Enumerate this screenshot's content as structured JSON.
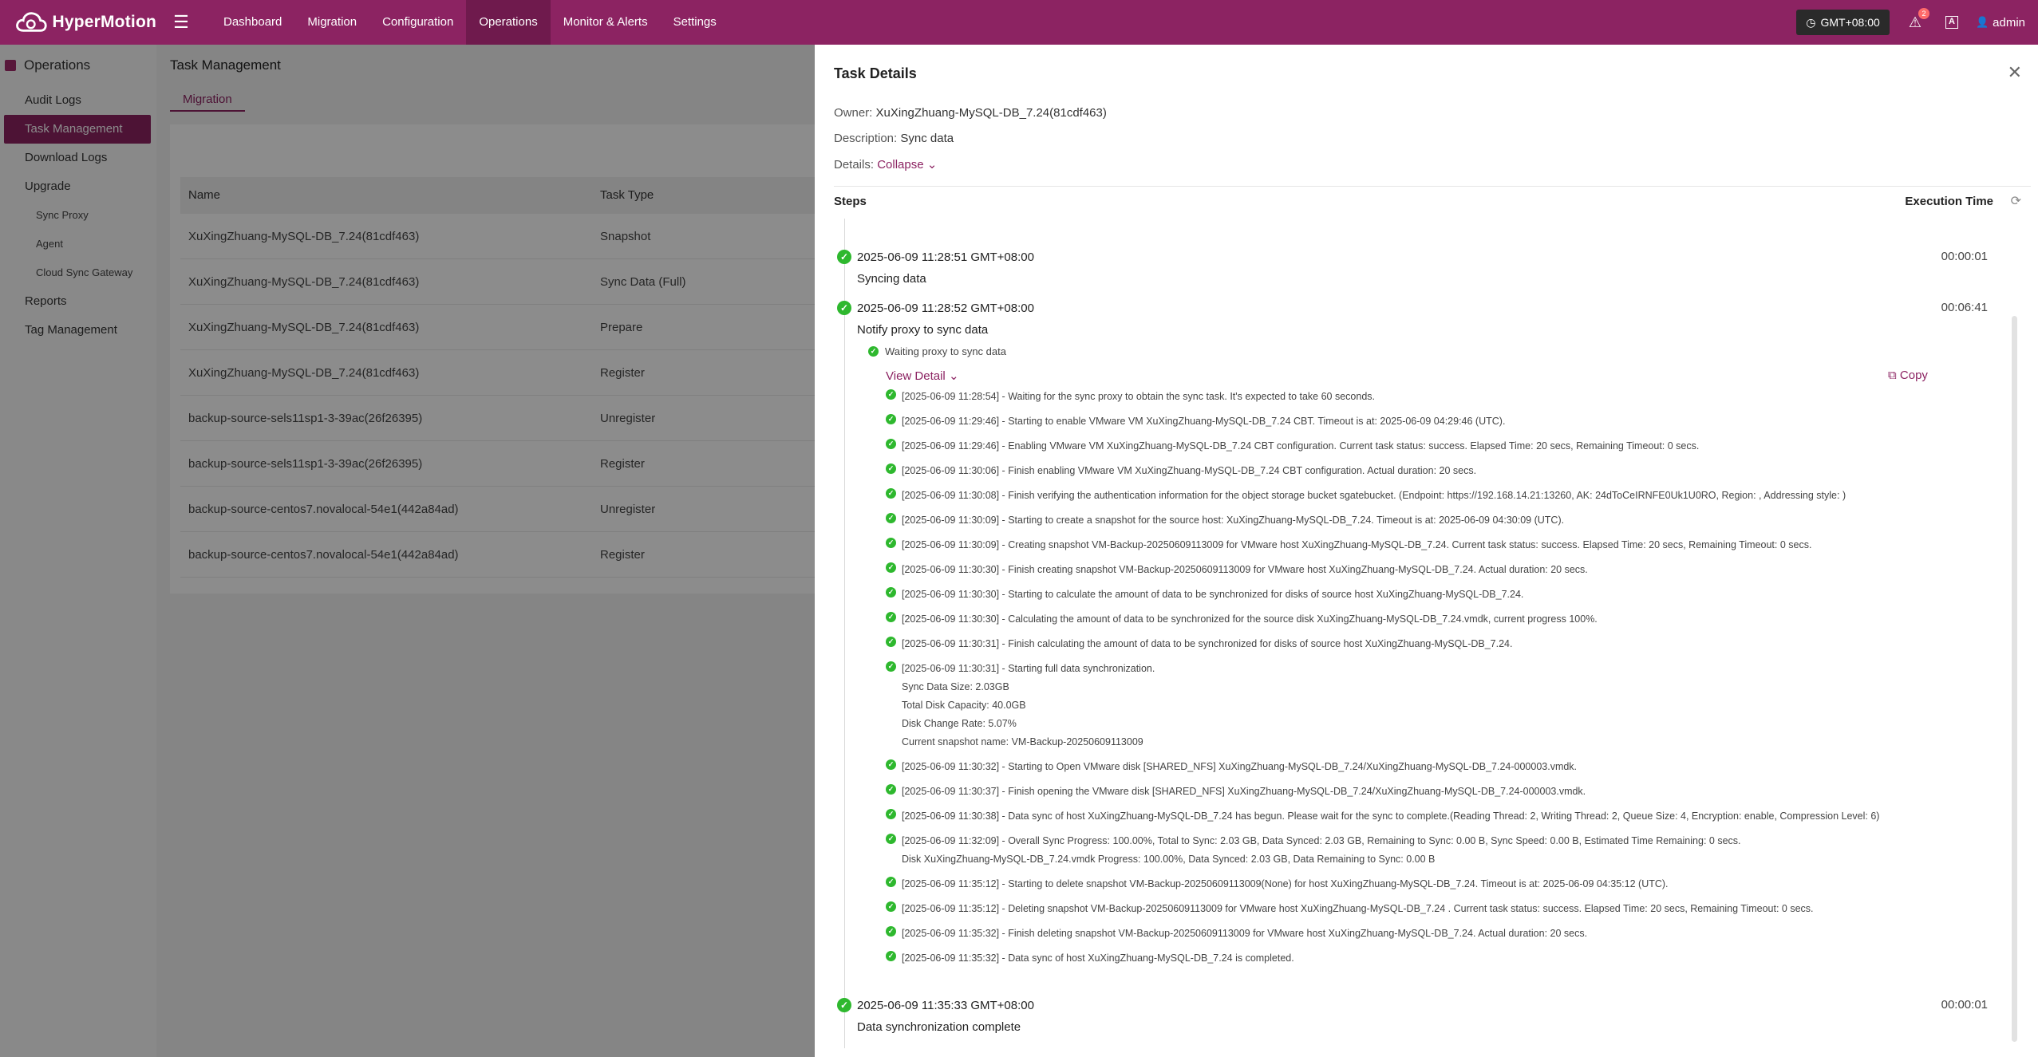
{
  "app": {
    "name": "HyperMotion"
  },
  "nav": [
    "Dashboard",
    "Migration",
    "Configuration",
    "Operations",
    "Monitor & Alerts",
    "Settings"
  ],
  "top": {
    "timezone": "GMT+08:00",
    "notifications": "2",
    "lang": "A",
    "user": "admin"
  },
  "sidebar": {
    "title": "Operations",
    "items": [
      "Audit Logs",
      "Task Management",
      "Download Logs",
      "Upgrade"
    ],
    "sub": [
      "Sync Proxy",
      "Agent",
      "Cloud Sync Gateway"
    ],
    "items2": [
      "Reports",
      "Tag Management"
    ]
  },
  "page": {
    "title": "Task Management",
    "tab": "Migration"
  },
  "table": {
    "headers": [
      "Name",
      "Task Type"
    ],
    "rows": [
      [
        "XuXingZhuang-MySQL-DB_7.24(81cdf463)",
        "Snapshot"
      ],
      [
        "XuXingZhuang-MySQL-DB_7.24(81cdf463)",
        "Sync Data (Full)"
      ],
      [
        "XuXingZhuang-MySQL-DB_7.24(81cdf463)",
        "Prepare"
      ],
      [
        "XuXingZhuang-MySQL-DB_7.24(81cdf463)",
        "Register"
      ],
      [
        "backup-source-sels11sp1-3-39ac(26f26395)",
        "Unregister"
      ],
      [
        "backup-source-sels11sp1-3-39ac(26f26395)",
        "Register"
      ],
      [
        "backup-source-centos7.novalocal-54e1(442a84ad)",
        "Unregister"
      ],
      [
        "backup-source-centos7.novalocal-54e1(442a84ad)",
        "Register"
      ]
    ]
  },
  "drawer": {
    "title": "Task Details",
    "owner_label": "Owner:",
    "owner": "XuXingZhuang-MySQL-DB_7.24(81cdf463)",
    "description_label": "Description:",
    "description": "Sync data",
    "details_label": "Details:",
    "collapse": "Collapse",
    "steps_label": "Steps",
    "exec_label": "Execution Time",
    "steps": [
      {
        "time": "2025-06-09 11:28:51 GMT+08:00",
        "name": "Syncing data",
        "duration": "00:00:01"
      },
      {
        "time": "2025-06-09 11:28:52 GMT+08:00",
        "name": "Notify proxy to sync data",
        "duration": "00:06:41"
      },
      {
        "time": "2025-06-09 11:35:33 GMT+08:00",
        "name": "Data synchronization complete",
        "duration": "00:00:01"
      }
    ],
    "sub_step": "Waiting proxy to sync data",
    "view_detail": "View Detail",
    "copy": "Copy",
    "logs": [
      [
        "[2025-06-09 11:28:54] - Waiting for the sync proxy to obtain the sync task. It's expected to take 60 seconds."
      ],
      [
        "[2025-06-09 11:29:46] - Starting to enable VMware VM XuXingZhuang-MySQL-DB_7.24 CBT. Timeout is at: 2025-06-09 04:29:46 (UTC)."
      ],
      [
        "[2025-06-09 11:29:46] - Enabling VMware VM XuXingZhuang-MySQL-DB_7.24 CBT configuration. Current task status: success. Elapsed Time: 20 secs, Remaining Timeout: 0 secs."
      ],
      [
        "[2025-06-09 11:30:06] - Finish enabling VMware VM XuXingZhuang-MySQL-DB_7.24 CBT configuration. Actual duration: 20 secs."
      ],
      [
        "[2025-06-09 11:30:08] - Finish verifying the authentication information for the object storage bucket sgatebucket. (Endpoint: https://192.168.14.21:13260, AK: 24dToCeIRNFE0Uk1U0RO, Region: , Addressing style: )"
      ],
      [
        "[2025-06-09 11:30:09] - Starting to create a snapshot for the source host: XuXingZhuang-MySQL-DB_7.24. Timeout is at: 2025-06-09 04:30:09 (UTC)."
      ],
      [
        "[2025-06-09 11:30:09] - Creating snapshot VM-Backup-20250609113009 for VMware host XuXingZhuang-MySQL-DB_7.24. Current task status: success. Elapsed Time: 20 secs, Remaining Timeout: 0 secs."
      ],
      [
        "[2025-06-09 11:30:30] - Finish creating snapshot VM-Backup-20250609113009 for VMware host XuXingZhuang-MySQL-DB_7.24. Actual duration: 20 secs."
      ],
      [
        "[2025-06-09 11:30:30] - Starting to calculate the amount of data to be synchronized for disks of source host XuXingZhuang-MySQL-DB_7.24."
      ],
      [
        "[2025-06-09 11:30:30] - Calculating the amount of data to be synchronized for the source disk XuXingZhuang-MySQL-DB_7.24.vmdk, current progress 100%."
      ],
      [
        "[2025-06-09 11:30:31] - Finish calculating the amount of data to be synchronized for disks of source host XuXingZhuang-MySQL-DB_7.24."
      ],
      [
        "[2025-06-09 11:30:31] - Starting full data synchronization.",
        "Sync Data Size: 2.03GB",
        "Total Disk Capacity: 40.0GB",
        "Disk Change Rate: 5.07%",
        "Current snapshot name: VM-Backup-20250609113009"
      ],
      [
        "[2025-06-09 11:30:32] - Starting to Open VMware disk [SHARED_NFS] XuXingZhuang-MySQL-DB_7.24/XuXingZhuang-MySQL-DB_7.24-000003.vmdk."
      ],
      [
        "[2025-06-09 11:30:37] - Finish opening the VMware disk [SHARED_NFS] XuXingZhuang-MySQL-DB_7.24/XuXingZhuang-MySQL-DB_7.24-000003.vmdk."
      ],
      [
        "[2025-06-09 11:30:38] - Data sync of host XuXingZhuang-MySQL-DB_7.24 has begun. Please wait for the sync to complete.(Reading Thread: 2, Writing Thread: 2, Queue Size: 4, Encryption: enable, Compression Level: 6)"
      ],
      [
        "[2025-06-09 11:32:09] - Overall Sync Progress: 100.00%, Total to Sync: 2.03 GB, Data Synced: 2.03 GB, Remaining to Sync: 0.00 B, Sync Speed: 0.00 B, Estimated Time Remaining: 0 secs.",
        "Disk XuXingZhuang-MySQL-DB_7.24.vmdk Progress: 100.00%, Data Synced: 2.03 GB, Data Remaining to Sync: 0.00 B"
      ],
      [
        "[2025-06-09 11:35:12] - Starting to delete snapshot VM-Backup-20250609113009(None) for host XuXingZhuang-MySQL-DB_7.24. Timeout is at: 2025-06-09 04:35:12 (UTC)."
      ],
      [
        "[2025-06-09 11:35:12] - Deleting snapshot VM-Backup-20250609113009 for VMware host XuXingZhuang-MySQL-DB_7.24 . Current task status: success. Elapsed Time: 20 secs, Remaining Timeout: 0 secs."
      ],
      [
        "[2025-06-09 11:35:32] - Finish deleting snapshot VM-Backup-20250609113009 for VMware host XuXingZhuang-MySQL-DB_7.24. Actual duration: 20 secs."
      ],
      [
        "[2025-06-09 11:35:32] - Data sync of host XuXingZhuang-MySQL-DB_7.24 is completed."
      ]
    ]
  }
}
